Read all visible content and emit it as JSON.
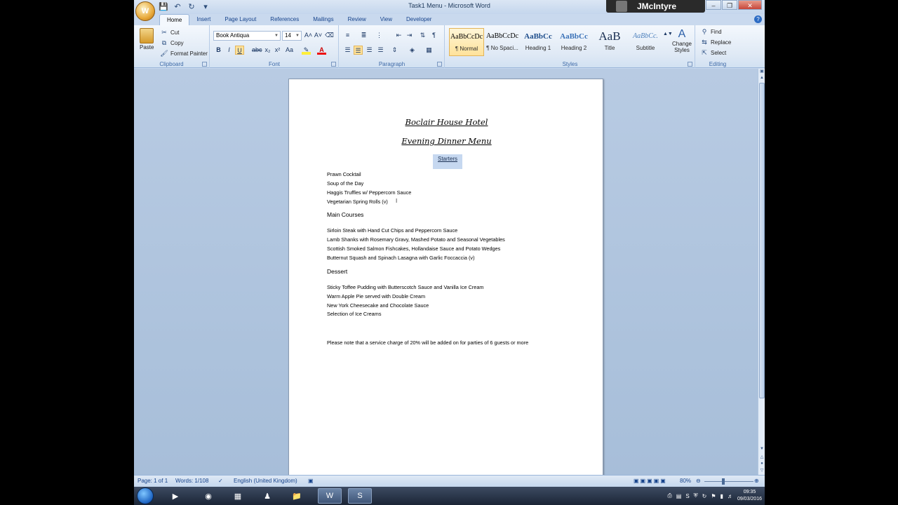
{
  "window": {
    "title": "Task1 Menu - Microsoft Word",
    "user": "JMcIntyre"
  },
  "tabs": [
    "Home",
    "Insert",
    "Page Layout",
    "References",
    "Mailings",
    "Review",
    "View",
    "Developer"
  ],
  "ribbon": {
    "clipboard": {
      "paste": "Paste",
      "cut": "Cut",
      "copy": "Copy",
      "format_painter": "Format Painter",
      "label": "Clipboard"
    },
    "font": {
      "name": "Book Antiqua",
      "size": "14",
      "label": "Font"
    },
    "paragraph": {
      "label": "Paragraph"
    },
    "styles": {
      "items": [
        {
          "sample": "AaBbCcDc",
          "name": "¶ Normal"
        },
        {
          "sample": "AaBbCcDc",
          "name": "¶ No Spaci..."
        },
        {
          "sample": "AaBbCc",
          "name": "Heading 1"
        },
        {
          "sample": "AaBbCc",
          "name": "Heading 2"
        },
        {
          "sample": "AaB",
          "name": "Title"
        },
        {
          "sample": "AaBbCc.",
          "name": "Subtitle"
        }
      ],
      "change_styles": "Change Styles",
      "label": "Styles"
    },
    "editing": {
      "find": "Find",
      "replace": "Replace",
      "select": "Select",
      "label": "Editing"
    }
  },
  "document": {
    "title1": "Boclair House Hotel",
    "title2": "Evening Dinner Menu",
    "starters_heading": "Starters",
    "starters": [
      "Prawn Cocktail",
      "Soup of the Day",
      "Haggis Truffles w/ Peppercorn Sauce",
      "Vegetarian Spring Rolls (v)"
    ],
    "main_heading": "Main Courses",
    "mains": [
      "Sirloin Steak with Hand Cut Chips and Peppercorn Sauce",
      "Lamb Shanks with Rosemary Gravy, Mashed Potato and Seasonal Vegetables",
      "Scottish Smoked Salmon Fishcakes, Hollandaise Sauce and Potato Wedges",
      "Butternut Squash and Spinach Lasagna with Garlic Foccaccia (v)"
    ],
    "dessert_heading": "Dessert",
    "desserts": [
      "Sticky Toffee Pudding with Butterscotch Sauce and Vanilla Ice Cream",
      "Warm Apple Pie served with Double Cream",
      "New York Cheesecake and Chocolate Sauce",
      "Selection of Ice Creams"
    ],
    "note": "Please note that a service charge of 20% will be added on for parties of 6 guests or more"
  },
  "status": {
    "page": "Page: 1 of 1",
    "words": "Words: 1/108",
    "language": "English (United Kingdom)",
    "zoom": "80%"
  },
  "taskbar": {
    "time": "09:35",
    "date": "09/03/2016"
  }
}
